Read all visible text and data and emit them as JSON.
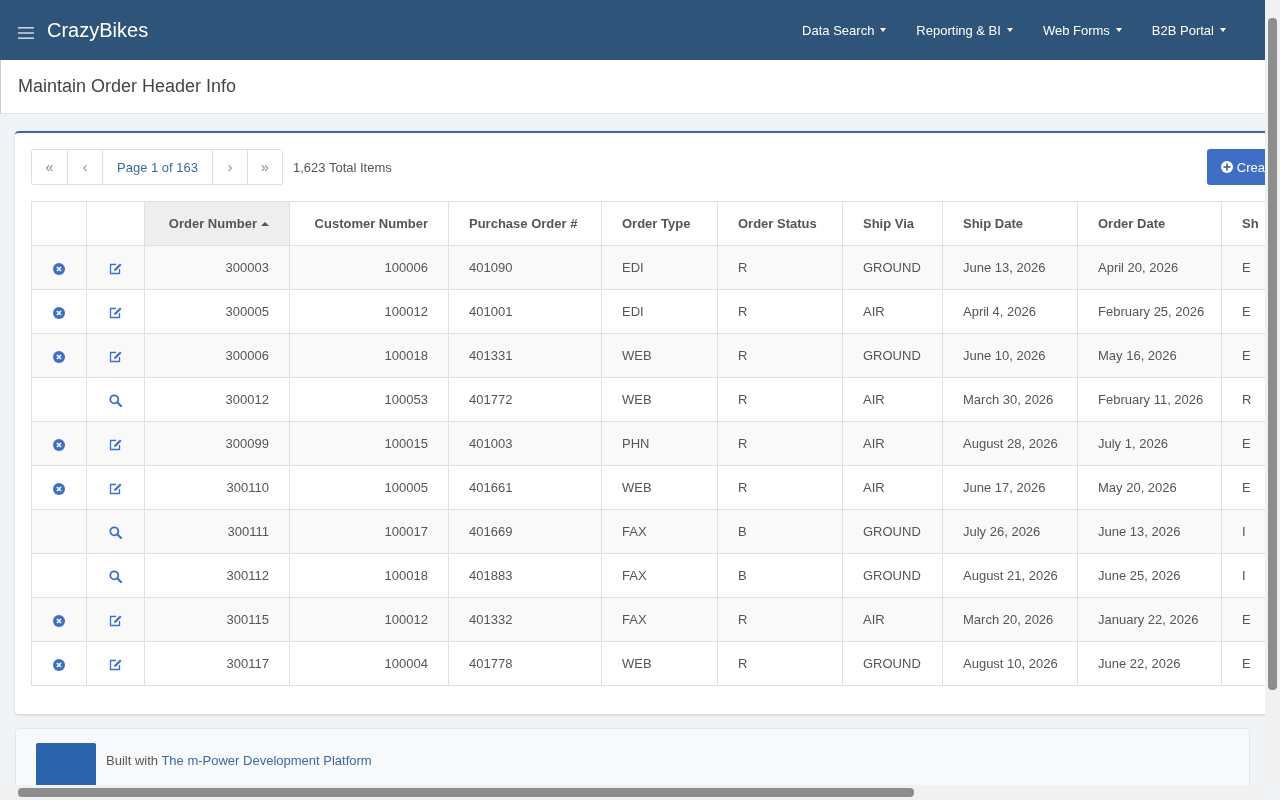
{
  "navbar": {
    "brand": "CrazyBikes",
    "menus": [
      {
        "label": "Data Search"
      },
      {
        "label": "Reporting & BI"
      },
      {
        "label": "Web Forms"
      },
      {
        "label": "B2B Portal"
      }
    ]
  },
  "page_title": "Maintain Order Header Info",
  "pager": {
    "first": "«",
    "prev": "‹",
    "page": "Page 1 of 163",
    "next": "›",
    "last": "»",
    "total": "1,623 Total Items"
  },
  "create_button": "Crea",
  "table": {
    "columns": [
      {
        "label": "Order Number",
        "sorted": true
      },
      {
        "label": "Customer Number",
        "sorted": false
      },
      {
        "label": "Purchase Order #",
        "sorted": false
      },
      {
        "label": "Order Type",
        "sorted": false
      },
      {
        "label": "Order Status",
        "sorted": false
      },
      {
        "label": "Ship Via",
        "sorted": false
      },
      {
        "label": "Ship Date",
        "sorted": false
      },
      {
        "label": "Order Date",
        "sorted": false
      },
      {
        "label": "Sh",
        "sorted": false
      }
    ],
    "rows": [
      {
        "kind": "editable",
        "cells": [
          "300003",
          "100006",
          "401090",
          "EDI",
          "R",
          "GROUND",
          "June 13, 2026",
          "April 20, 2026",
          "E"
        ]
      },
      {
        "kind": "editable",
        "cells": [
          "300005",
          "100012",
          "401001",
          "EDI",
          "R",
          "AIR",
          "April 4, 2026",
          "February 25, 2026",
          "E"
        ]
      },
      {
        "kind": "editable",
        "cells": [
          "300006",
          "100018",
          "401331",
          "WEB",
          "R",
          "GROUND",
          "June 10, 2026",
          "May 16, 2026",
          "E"
        ]
      },
      {
        "kind": "view",
        "cells": [
          "300012",
          "100053",
          "401772",
          "WEB",
          "R",
          "AIR",
          "March 30, 2026",
          "February 11, 2026",
          "R"
        ]
      },
      {
        "kind": "editable",
        "cells": [
          "300099",
          "100015",
          "401003",
          "PHN",
          "R",
          "AIR",
          "August 28, 2026",
          "July 1, 2026",
          "E"
        ]
      },
      {
        "kind": "editable",
        "cells": [
          "300110",
          "100005",
          "401661",
          "WEB",
          "R",
          "AIR",
          "June 17, 2026",
          "May 20, 2026",
          "E"
        ]
      },
      {
        "kind": "view",
        "cells": [
          "300111",
          "100017",
          "401669",
          "FAX",
          "B",
          "GROUND",
          "July 26, 2026",
          "June 13, 2026",
          "I"
        ]
      },
      {
        "kind": "view",
        "cells": [
          "300112",
          "100018",
          "401883",
          "FAX",
          "B",
          "GROUND",
          "August 21, 2026",
          "June 25, 2026",
          "I"
        ]
      },
      {
        "kind": "editable",
        "cells": [
          "300115",
          "100012",
          "401332",
          "FAX",
          "R",
          "AIR",
          "March 20, 2026",
          "January 22, 2026",
          "E"
        ]
      },
      {
        "kind": "editable",
        "cells": [
          "300117",
          "100004",
          "401778",
          "WEB",
          "R",
          "GROUND",
          "August 10, 2026",
          "June 22, 2026",
          "E"
        ]
      }
    ]
  },
  "footer": {
    "text": "Built with ",
    "link": "The m-Power Development Platform"
  }
}
